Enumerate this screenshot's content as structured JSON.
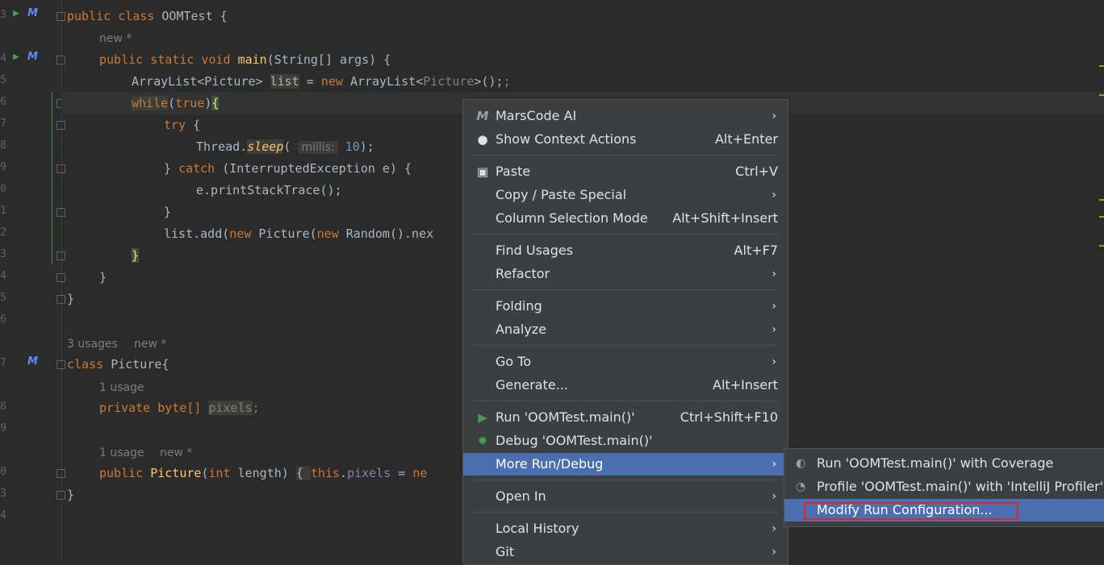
{
  "gutter": {
    "line_numbers": [
      "3",
      "",
      "4",
      "5",
      "6",
      "7",
      "8",
      "9",
      "0",
      "1",
      "2",
      "3",
      "4",
      "5",
      "6",
      "",
      "7",
      "",
      "8",
      "9",
      "",
      "0",
      "3",
      "4"
    ]
  },
  "code": {
    "l1": {
      "kw": "public class ",
      "name": "OOMTest {"
    },
    "inlay_new1": "new *",
    "l2": {
      "kw1": "public static void ",
      "fn": "main",
      "rest": "(String[] args) {"
    },
    "l3": {
      "a": "ArrayList<Picture> ",
      "var": "list",
      "b": " = ",
      "kw": "new ",
      "c": "ArrayList<",
      "d": "Picture",
      "e": ">();"
    },
    "l4": {
      "kw": "while",
      "a": "(",
      "kw2": "true",
      "b": ")",
      "brace": "{"
    },
    "l5": {
      "kw": "try",
      "a": " {"
    },
    "l6": {
      "a": "Thread.",
      "fn": "sleep",
      "b": "( ",
      "hint": "millis:",
      "num": " 10",
      "c": ");"
    },
    "l7": {
      "a": "} ",
      "kw": "catch",
      "b": " (InterruptedException e) {"
    },
    "l8": {
      "a": "e.printStackTrace();"
    },
    "l9": {
      "a": "}"
    },
    "l10": {
      "a": "list.add(",
      "kw": "new ",
      "b": "Picture(",
      "kw2": "new ",
      "c": "Random().nex"
    },
    "l11": {
      "brace": "}"
    },
    "l12": {
      "a": "}"
    },
    "l13": {
      "a": "}"
    },
    "inlay_usages": "3 usages",
    "inlay_new2": "new *",
    "l14": {
      "kw": "class ",
      "a": "Picture{"
    },
    "inlay_usage1": "1 usage",
    "l15": {
      "kw": "private byte",
      "a": "[] ",
      "field": "pixels",
      "b": ";"
    },
    "inlay_usage2": "1 usage",
    "inlay_new3": "new *",
    "l16": {
      "kw": "public ",
      "fn": "Picture",
      "a": "(",
      "kw2": "int",
      "b": " length) ",
      "c": "{ ",
      "kw3": "this",
      "d": ".",
      "field": "pixels",
      "e": " = ",
      "kw4": "ne"
    },
    "l17": {
      "a": "}"
    }
  },
  "context_menu": {
    "items": [
      {
        "label": "MarsCode AI",
        "shortcut": "",
        "submenu": true,
        "icon": "marscode-icon"
      },
      {
        "label": "Show Context Actions",
        "shortcut": "Alt+Enter",
        "submenu": false,
        "icon": "lightbulb-icon"
      },
      {
        "label": "Paste",
        "shortcut": "Ctrl+V",
        "submenu": false,
        "icon": "clipboard-icon"
      },
      {
        "label": "Copy / Paste Special",
        "shortcut": "",
        "submenu": true
      },
      {
        "label": "Column Selection Mode",
        "shortcut": "Alt+Shift+Insert",
        "submenu": false
      },
      {
        "label": "Find Usages",
        "shortcut": "Alt+F7",
        "submenu": false
      },
      {
        "label": "Refactor",
        "shortcut": "",
        "submenu": true
      },
      {
        "label": "Folding",
        "shortcut": "",
        "submenu": true
      },
      {
        "label": "Analyze",
        "shortcut": "",
        "submenu": true
      },
      {
        "label": "Go To",
        "shortcut": "",
        "submenu": true
      },
      {
        "label": "Generate...",
        "shortcut": "Alt+Insert",
        "submenu": false
      },
      {
        "label": "Run 'OOMTest.main()'",
        "shortcut": "Ctrl+Shift+F10",
        "submenu": false,
        "icon": "run-icon"
      },
      {
        "label": "Debug 'OOMTest.main()'",
        "shortcut": "",
        "submenu": false,
        "icon": "debug-icon"
      },
      {
        "label": "More Run/Debug",
        "shortcut": "",
        "submenu": true,
        "selected": true
      },
      {
        "label": "Open In",
        "shortcut": "",
        "submenu": true
      },
      {
        "label": "Local History",
        "shortcut": "",
        "submenu": true
      },
      {
        "label": "Git",
        "shortcut": "",
        "submenu": true
      }
    ],
    "arrow": "›"
  },
  "sub_menu": {
    "items": [
      {
        "label": "Run 'OOMTest.main()' with Coverage",
        "icon": "coverage-icon"
      },
      {
        "label": "Profile 'OOMTest.main()' with 'IntelliJ Profiler'",
        "icon": "profiler-icon"
      },
      {
        "label": "Modify Run Configuration...",
        "selected": true
      }
    ]
  },
  "colors": {
    "accent": "#4b6eaf",
    "highlight_box": "#e0262b",
    "keyword": "#cc7832",
    "function": "#ffc66d"
  }
}
